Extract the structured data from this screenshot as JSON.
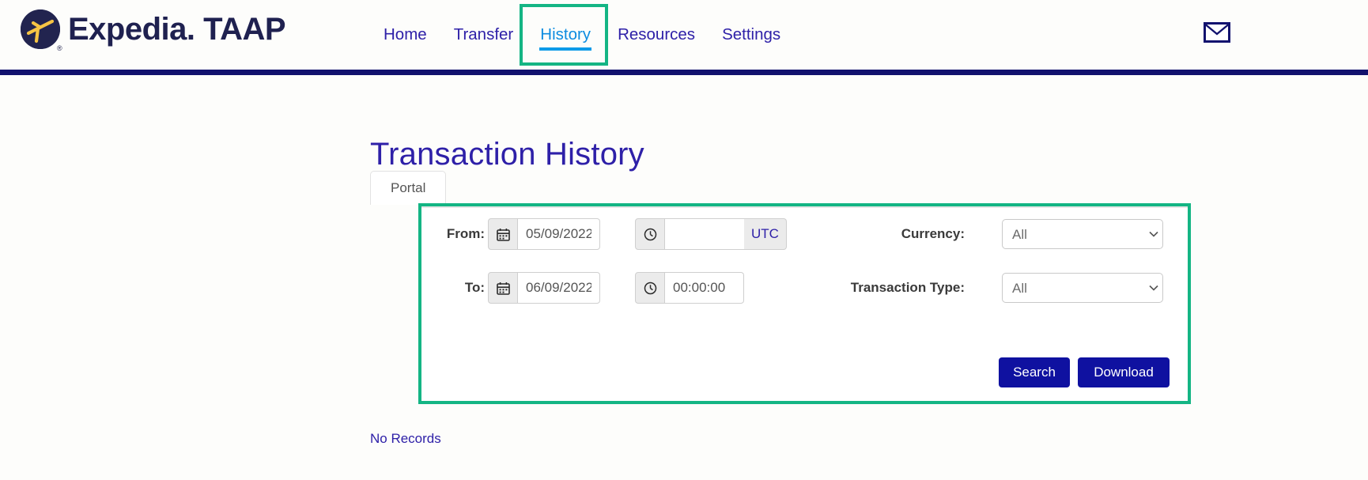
{
  "header": {
    "brand_primary": "Expedia",
    "brand_dot": ".",
    "brand_secondary": " TAAP",
    "brand_reg": "®",
    "nav": [
      {
        "label": "Home",
        "active": false
      },
      {
        "label": "Transfer",
        "active": false
      },
      {
        "label": "History",
        "active": true
      },
      {
        "label": "Resources",
        "active": false
      },
      {
        "label": "Settings",
        "active": false
      }
    ],
    "mail_icon": "envelope-icon",
    "accent_bar_color": "#12126e",
    "highlight_color": "#14b584",
    "active_nav_color": "#0d8ce0",
    "nav_color": "#2e20a8"
  },
  "main": {
    "page_title": "Transaction History",
    "tabs": [
      {
        "label": "Portal",
        "active": true
      }
    ],
    "footer_note": "No Records"
  },
  "search_form": {
    "from": {
      "label": "From:",
      "calendar_icon": "calendar-icon",
      "date_value": "05/09/2022",
      "date_placeholder": "",
      "clock_icon": "clock-icon",
      "time_value": "",
      "time_placeholder": "",
      "timezone_suffix": "UTC"
    },
    "to": {
      "label": "To:",
      "calendar_icon": "calendar-icon",
      "date_value": "06/09/2022",
      "date_placeholder": "",
      "clock_icon": "clock-icon",
      "time_value": "00:00:00",
      "time_placeholder": ""
    },
    "currency": {
      "label": "Currency:",
      "selected": "All",
      "options": [
        "All"
      ]
    },
    "transaction_type": {
      "label": "Transaction Type:",
      "selected": "All",
      "options": [
        "All"
      ]
    },
    "buttons": {
      "search": "Search",
      "download": "Download",
      "color": "#0f11a0"
    }
  }
}
